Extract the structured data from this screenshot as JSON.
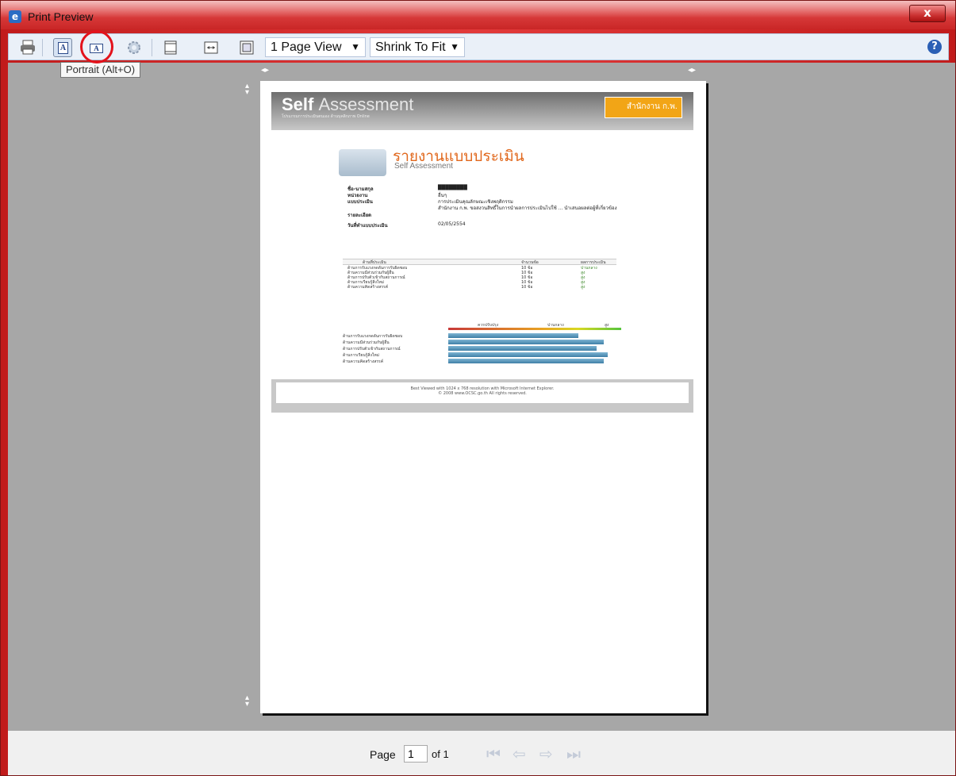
{
  "window": {
    "title": "Print Preview",
    "app_icon": "ie-icon",
    "close_icon": "x"
  },
  "toolbar": {
    "view_mode": "1 Page View",
    "scale_mode": "Shrink To Fit",
    "portrait_tooltip": "Portrait (Alt+O)"
  },
  "report": {
    "logo_title_bold": "Self",
    "logo_title_rest": "Assessment",
    "logo_subtitle": "โปรแกรมการประเมินตนเอง ด้านบุคลิกภาพ Online",
    "org_logo_text": "สำนักงาน ก.พ.",
    "banner_title": "รายงานแบบประเมิน",
    "banner_subtitle": "Self Assessment",
    "info": [
      {
        "k": "ชื่อ-นามสกุล",
        "v": "████████"
      },
      {
        "k": "หน่วยงาน",
        "v": "อื่นๆ"
      },
      {
        "k": "แบบประเมิน",
        "v": "การประเมินคุณลักษณะเชิงพฤติกรรม"
      },
      {
        "k": "รายละเอียด",
        "v": "สำนักงาน ก.พ. ขอสงวนสิทธิ์ในการนำผลการประเมินไปใช้ ... นำเสนอผลต่อผู้ที่เกี่ยวข้อง"
      },
      {
        "k": "วันที่ทำแบบประเมิน",
        "v": "02/05/2554"
      }
    ],
    "table_headers": [
      "ด้านที่ประเมิน",
      "จำนวนข้อ",
      "ผลการประเมิน"
    ],
    "table_rows": [
      [
        "ด้านการรับแรงกดดันการรับผิดชอบ",
        "10 ข้อ",
        "ปานกลาง"
      ],
      [
        "ด้านความมีส่วนร่วมกับผู้อื่น",
        "10 ข้อ",
        "สูง"
      ],
      [
        "ด้านการปรับตัวเข้ากับสถานการณ์",
        "10 ข้อ",
        "สูง"
      ],
      [
        "ด้านการเรียนรู้สิ่งใหม่",
        "10 ข้อ",
        "สูง"
      ],
      [
        "ด้านความคิดสร้างสรรค์",
        "10 ข้อ",
        "สูง"
      ]
    ],
    "scale_labels": [
      "ควรปรับปรุง",
      "ปานกลาง",
      "สูง"
    ],
    "bar_labels": [
      "ด้านการรับแรงกดดันการรับผิดชอบ",
      "ด้านความมีส่วนร่วมกับผู้อื่น",
      "ด้านการปรับตัวเข้ากับสถานการณ์",
      "ด้านการเรียนรู้สิ่งใหม่",
      "ด้านความคิดสร้างสรรค์"
    ],
    "bar_levels": [
      0.75,
      0.9,
      0.86,
      0.92,
      0.9
    ],
    "footer_line1": "Best Viewed with 1024 x 768 resolution with Microsoft Internet Explorer.",
    "footer_line2": "© 2008 www.OCSC.go.th All rights reserved."
  },
  "pager": {
    "label": "Page",
    "current": "1",
    "total": "of 1"
  },
  "colors": {
    "accent": "#e1681d",
    "highlight_circle": "#e3121b",
    "preview_bg": "#a7a7a7"
  }
}
